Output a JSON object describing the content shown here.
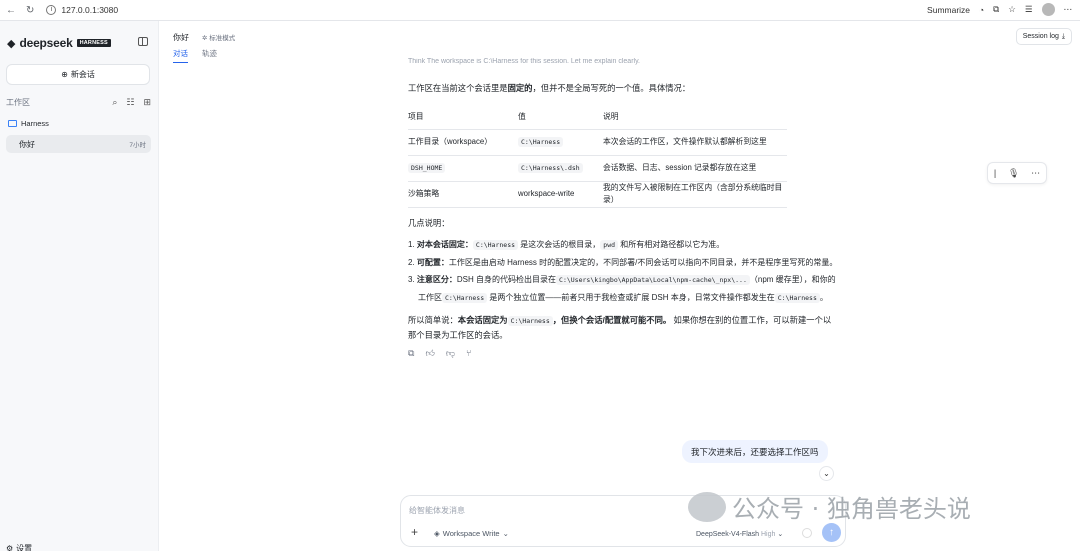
{
  "browser": {
    "url": "127.0.0.1:3080",
    "summarize": "Summarize",
    "nav_icons": [
      "back-icon",
      "reload-icon",
      "info-icon"
    ],
    "toolbar_icons": [
      "copilot-icon",
      "extensions-icon",
      "favorite-icon",
      "favorites-bar-icon",
      "profile-avatar",
      "more-icon"
    ]
  },
  "sidebar": {
    "brand": "deepseek",
    "badge": "HARNESS",
    "new_chat": "新会话",
    "workspace_title": "工作区",
    "folder": "Harness",
    "sessions": [
      {
        "title": "你好",
        "time": "7小时"
      }
    ],
    "settings": "设置"
  },
  "header": {
    "title": "你好",
    "mode": "标准模式",
    "tabs": [
      {
        "label": "对话",
        "active": true
      },
      {
        "label": "轨迹",
        "active": false
      }
    ],
    "session_log": "Session log"
  },
  "message": {
    "think": "Think    The workspace is C:\\Harness for this session. Let me explain clearly.",
    "intro_1": "工作区在当前这个会话里是",
    "intro_bold": "固定的",
    "intro_2": "，但并不是全局写死的一个值。具体情况：",
    "table": {
      "headers": [
        "项目",
        "值",
        "说明"
      ],
      "rows": [
        {
          "item": "工作目录（workspace）",
          "value": "C:\\Harness",
          "value_code": true,
          "desc": "本次会话的工作区，文件操作默认都解析到这里",
          "item_code": false
        },
        {
          "item": "DSH_HOME",
          "value": "C:\\Harness\\.dsh",
          "value_code": true,
          "desc": "会话数据、日志、session 记录都存放在这里",
          "item_code": true
        },
        {
          "item": "沙箱策略",
          "value": "workspace-write",
          "value_code": false,
          "desc": "我的文件写入被限制在工作区内（含部分系统临时目录）",
          "item_code": false
        }
      ]
    },
    "notes_title": "几点说明：",
    "notes": {
      "n1_num": "1.",
      "n1_bold": "对本会话固定：",
      "n1_code": "C:\\Harness",
      "n1_text": "是这次会话的根目录，",
      "n1_code2": "pwd",
      "n1_text2": "和所有相对路径都以它为准。",
      "n2_num": "2.",
      "n2_bold": "可配置：",
      "n2_text": "工作区是由启动 Harness 时的配置决定的，不同部署/不同会话可以指向不同目录，并不是程序里写死的常量。",
      "n3_num": "3.",
      "n3_bold": "注意区分：",
      "n3_text": "DSH 自身的代码检出目录在",
      "n3_code": "C:\\Users\\kingbo\\AppData\\Local\\npm-cache\\_npx\\...",
      "n3_text2": "（npm 缓存里），和你的工作区",
      "n3_code2": "C:\\Harness",
      "n3_text3": "是两个独立位置——前者只用于我检查或扩展 DSH 本身，日常文件操作都发生在",
      "n3_code3": "C:\\Harness",
      "n3_text4": "。"
    },
    "summary_1": "所以简单说：",
    "summary_bold_1": "本会话固定为",
    "summary_code": "C:\\Harness",
    "summary_bold_2": "，但换个会话/配置就可能不同。",
    "summary_2": "如果你想在别的位置工作，可以新建一个以那个目录为工作区的会话。",
    "action_icons": [
      "copy-icon",
      "thumbs-up-icon",
      "thumbs-down-icon",
      "branch-icon"
    ]
  },
  "user_message": "我下次进来后，还要选择工作区吗",
  "composer": {
    "placeholder": "给智能体发消息",
    "workspace": "Workspace Write",
    "model": "DeepSeek-V4-Flash",
    "effort": "High"
  },
  "watermark": "公众号 · 独角兽老头说"
}
